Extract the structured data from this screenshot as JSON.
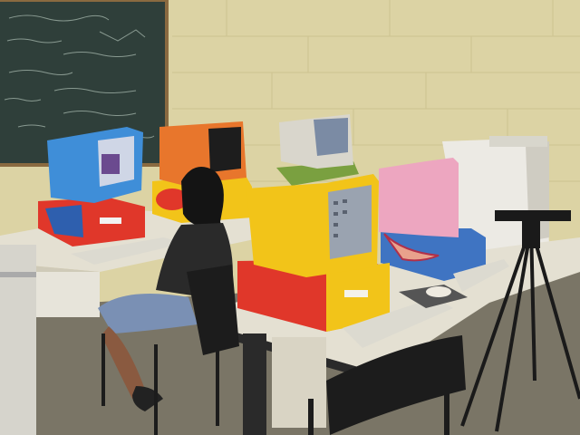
{
  "scene": {
    "palette": {
      "wall": "#dcd3a4",
      "wall_shadow": "#c9be8c",
      "chalkboard": "#2f3f3a",
      "chalk": "#a9b7ae",
      "floor": "#6f6a5c",
      "desk_top": "#e4e0d2",
      "desk_edge": "#2a2a2a",
      "monitor_blue": "#3f8ed8",
      "monitor_orange": "#e8762c",
      "monitor_yellow": "#f2c419",
      "monitor_pink": "#eda6c0",
      "monitor_beige": "#d9d6cc",
      "base_red": "#e0372a",
      "keyboard": "#dcdad0",
      "chair": "#1c1c1c",
      "tripod": "#1a1a1a",
      "screen": "#9aa3b0"
    }
  }
}
